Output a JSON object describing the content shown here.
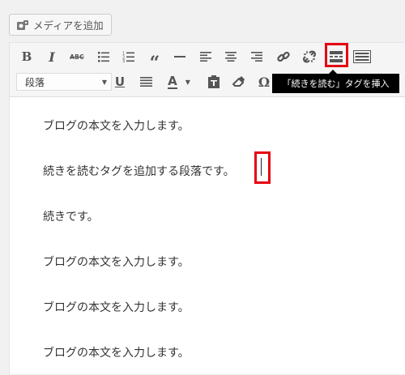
{
  "media_button": {
    "label": "メディアを追加",
    "icon": "media-icon"
  },
  "toolbar": {
    "row1": [
      {
        "name": "bold",
        "icon": "bold-icon",
        "text": "B"
      },
      {
        "name": "italic",
        "icon": "italic-icon",
        "text": "I"
      },
      {
        "name": "strikethrough",
        "icon": "strikethrough-icon",
        "text": "ABC"
      },
      {
        "name": "bulleted-list",
        "icon": "bulleted-list-icon"
      },
      {
        "name": "numbered-list",
        "icon": "numbered-list-icon"
      },
      {
        "name": "blockquote",
        "icon": "blockquote-icon",
        "text": "“"
      },
      {
        "name": "horizontal-line",
        "icon": "horizontal-line-icon"
      },
      {
        "name": "align-left",
        "icon": "align-left-icon"
      },
      {
        "name": "align-center",
        "icon": "align-center-icon"
      },
      {
        "name": "align-right",
        "icon": "align-right-icon"
      },
      {
        "name": "insert-link",
        "icon": "link-icon"
      },
      {
        "name": "remove-link",
        "icon": "unlink-icon"
      },
      {
        "name": "insert-read-more",
        "icon": "read-more-icon"
      },
      {
        "name": "toolbar-toggle",
        "icon": "keyboard-icon"
      }
    ],
    "format_select": {
      "value": "段落"
    },
    "row2": [
      {
        "name": "underline",
        "icon": "underline-icon",
        "text": "U"
      },
      {
        "name": "justify",
        "icon": "justify-icon"
      },
      {
        "name": "text-color",
        "icon": "text-color-icon",
        "text": "A"
      },
      {
        "name": "paste-as-text",
        "icon": "clipboard-icon"
      },
      {
        "name": "clear-formatting",
        "icon": "eraser-icon"
      },
      {
        "name": "special-character",
        "icon": "omega-icon",
        "text": "Ω"
      }
    ],
    "tooltip": "「続きを読む」タグを挿入",
    "highlight_color": "#e60012"
  },
  "content": {
    "paragraphs": [
      "ブログの本文を入力します。",
      "続きを読むタグを追加する段落です。",
      "続きです。",
      "ブログの本文を入力します。",
      "ブログの本文を入力します。",
      "ブログの本文を入力します。"
    ]
  }
}
